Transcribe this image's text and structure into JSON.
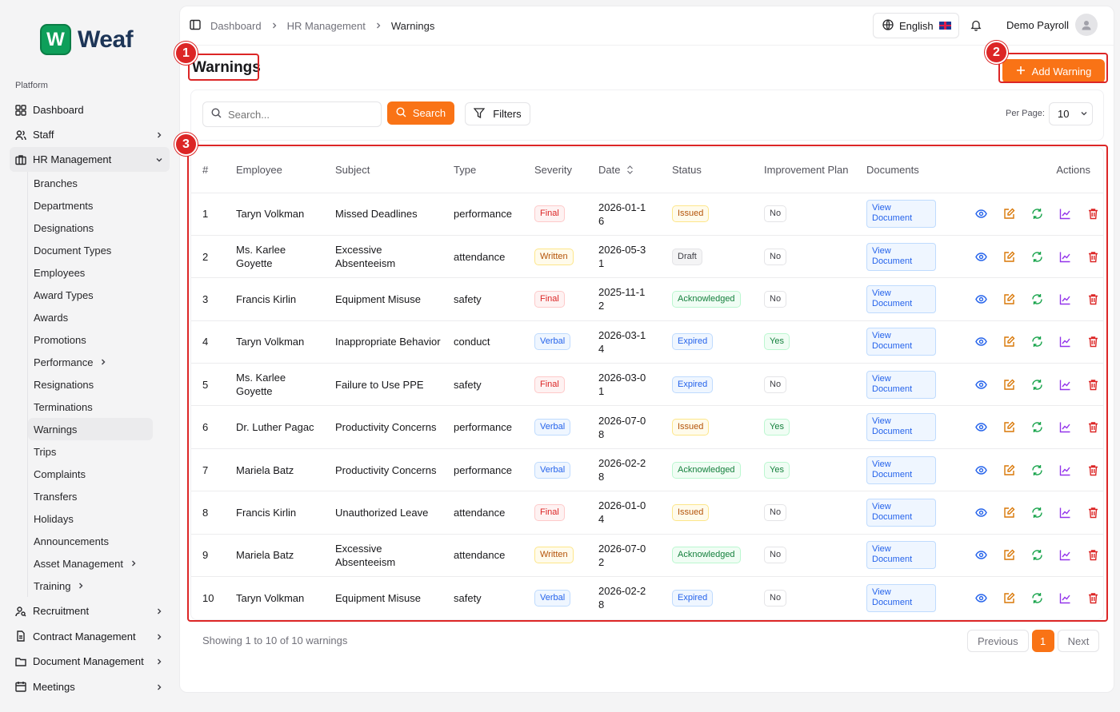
{
  "brand": {
    "mark": "W",
    "name": "Weaf"
  },
  "sidebar": {
    "section_label": "Platform",
    "items_top": [
      {
        "label": "Dashboard",
        "icon": "grid-icon"
      },
      {
        "label": "Staff",
        "icon": "users-icon"
      },
      {
        "label": "HR Management",
        "icon": "briefcase-icon"
      }
    ],
    "hr_sub": [
      "Branches",
      "Departments",
      "Designations",
      "Document Types",
      "Employees",
      "Award Types",
      "Awards",
      "Promotions",
      "Performance",
      "Resignations",
      "Terminations",
      "Warnings",
      "Trips",
      "Complaints",
      "Transfers",
      "Holidays",
      "Announcements",
      "Asset Management",
      "Training"
    ],
    "items_bottom": [
      {
        "label": "Recruitment",
        "icon": "user-search-icon"
      },
      {
        "label": "Contract Management",
        "icon": "file-text-icon"
      },
      {
        "label": "Document Management",
        "icon": "folder-icon"
      },
      {
        "label": "Meetings",
        "icon": "calendar-icon"
      }
    ]
  },
  "breadcrumb": {
    "items": [
      "Dashboard",
      "HR Management",
      "Warnings"
    ]
  },
  "topbar": {
    "language": "English",
    "user_name": "Demo Payroll"
  },
  "page": {
    "title": "Warnings",
    "add_button": "Add Warning"
  },
  "filters": {
    "search_placeholder": "Search...",
    "search_button": "Search",
    "filters_button": "Filters",
    "per_page_label": "Per Page:",
    "per_page_value": "10"
  },
  "table": {
    "headers": {
      "num": "#",
      "employee": "Employee",
      "subject": "Subject",
      "type": "Type",
      "severity": "Severity",
      "date": "Date",
      "status": "Status",
      "improvement": "Improvement Plan",
      "documents": "Documents",
      "actions": "Actions"
    },
    "doc_button": "View Document",
    "rows": [
      {
        "num": "1",
        "employee": "Taryn Volkman",
        "subject": "Missed Deadlines",
        "type": "performance",
        "severity": "Final",
        "date": "2026-01-16",
        "status": "Issued",
        "plan": "No"
      },
      {
        "num": "2",
        "employee": "Ms. Karlee Goyette",
        "subject": "Excessive Absenteeism",
        "type": "attendance",
        "severity": "Written",
        "date": "2026-05-31",
        "status": "Draft",
        "plan": "No"
      },
      {
        "num": "3",
        "employee": "Francis Kirlin",
        "subject": "Equipment Misuse",
        "type": "safety",
        "severity": "Final",
        "date": "2025-11-12",
        "status": "Acknowledged",
        "plan": "No"
      },
      {
        "num": "4",
        "employee": "Taryn Volkman",
        "subject": "Inappropriate Behavior",
        "type": "conduct",
        "severity": "Verbal",
        "date": "2026-03-14",
        "status": "Expired",
        "plan": "Yes"
      },
      {
        "num": "5",
        "employee": "Ms. Karlee Goyette",
        "subject": "Failure to Use PPE",
        "type": "safety",
        "severity": "Final",
        "date": "2026-03-01",
        "status": "Expired",
        "plan": "No"
      },
      {
        "num": "6",
        "employee": "Dr. Luther Pagac",
        "subject": "Productivity Concerns",
        "type": "performance",
        "severity": "Verbal",
        "date": "2026-07-08",
        "status": "Issued",
        "plan": "Yes"
      },
      {
        "num": "7",
        "employee": "Mariela Batz",
        "subject": "Productivity Concerns",
        "type": "performance",
        "severity": "Verbal",
        "date": "2026-02-28",
        "status": "Acknowledged",
        "plan": "Yes"
      },
      {
        "num": "8",
        "employee": "Francis Kirlin",
        "subject": "Unauthorized Leave",
        "type": "attendance",
        "severity": "Final",
        "date": "2026-01-04",
        "status": "Issued",
        "plan": "No"
      },
      {
        "num": "9",
        "employee": "Mariela Batz",
        "subject": "Excessive Absenteeism",
        "type": "attendance",
        "severity": "Written",
        "date": "2026-07-02",
        "status": "Acknowledged",
        "plan": "No"
      },
      {
        "num": "10",
        "employee": "Taryn Volkman",
        "subject": "Equipment Misuse",
        "type": "safety",
        "severity": "Verbal",
        "date": "2026-02-28",
        "status": "Expired",
        "plan": "No"
      }
    ]
  },
  "footer": {
    "summary": "Showing 1 to 10 of 10 warnings",
    "prev": "Previous",
    "page": "1",
    "next": "Next"
  },
  "callouts": [
    "1",
    "2",
    "3"
  ],
  "colors": {
    "accent": "#f97316",
    "callout": "#dc2626",
    "brand": "#0e9f5a"
  }
}
